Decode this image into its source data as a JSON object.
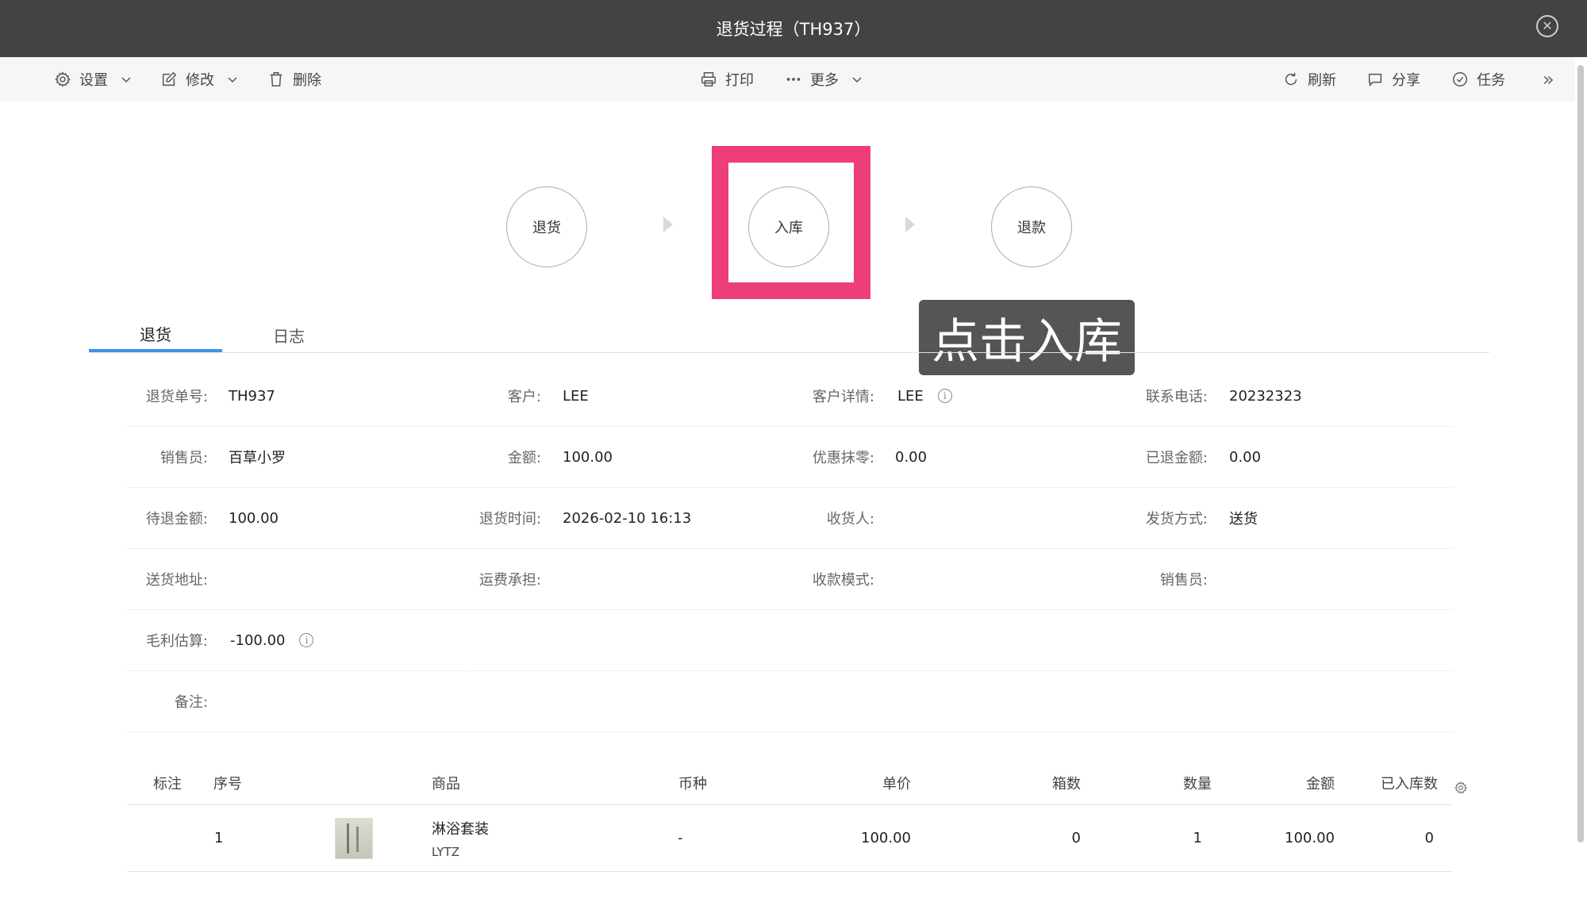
{
  "window": {
    "title": "退货过程（TH937）"
  },
  "toolbar": {
    "settings": "设置",
    "edit": "修改",
    "delete": "删除",
    "print": "打印",
    "more": "更多",
    "refresh": "刷新",
    "share": "分享",
    "task": "任务",
    "expand": "»"
  },
  "process": {
    "steps": [
      "退货",
      "入库",
      "退款"
    ],
    "active_step": "入库",
    "highlight_color": "#ee3d7b"
  },
  "tooltip": {
    "text": "点击入库"
  },
  "tabs": [
    "退货",
    "日志"
  ],
  "form": {
    "rows": [
      [
        {
          "label": "退货单号:",
          "value": "TH937"
        },
        {
          "label": "客户:",
          "value": "LEE"
        },
        {
          "label": "客户详情:",
          "value": "LEE"
        },
        {
          "label": "联系电话:",
          "value": "20232323"
        }
      ],
      [
        {
          "label": "销售员:",
          "value": "百草小罗"
        },
        {
          "label": "金额:",
          "value": "100.00"
        },
        {
          "label": "优惠抹零:",
          "value": "0.00"
        },
        {
          "label": "已退金额:",
          "value": "0.00"
        }
      ],
      [
        {
          "label": "待退金额:",
          "value": "100.00"
        },
        {
          "label": "退货时间:",
          "value": "2026-02-10 16:13"
        },
        {
          "label": "收货人:",
          "value": ""
        },
        {
          "label": "发货方式:",
          "value": "送货"
        }
      ],
      [
        {
          "label": "送货地址:",
          "value": ""
        },
        {
          "label": "运费承担:",
          "value": ""
        },
        {
          "label": "收款模式:",
          "value": ""
        },
        {
          "label": "销售员:",
          "value": ""
        }
      ],
      [
        {
          "label": "毛利估算:",
          "value": "-100.00"
        }
      ],
      [
        {
          "label": "备注:",
          "value": ""
        }
      ]
    ]
  },
  "table": {
    "headers": [
      "标注",
      "序号",
      "商品",
      "币种",
      "单价",
      "箱数",
      "数量",
      "金额",
      "已入库数"
    ],
    "rows": [
      {
        "index": "1",
        "product": "淋浴套装",
        "code": "LYTZ",
        "currency": "-",
        "unit_price": "100.00",
        "boxes": "0",
        "quantity": "1",
        "amount": "100.00",
        "stocked": "0"
      }
    ]
  },
  "colors": {
    "titlebar": "#434343",
    "accent": "#3c93e8",
    "highlight": "#ee3d7b"
  }
}
